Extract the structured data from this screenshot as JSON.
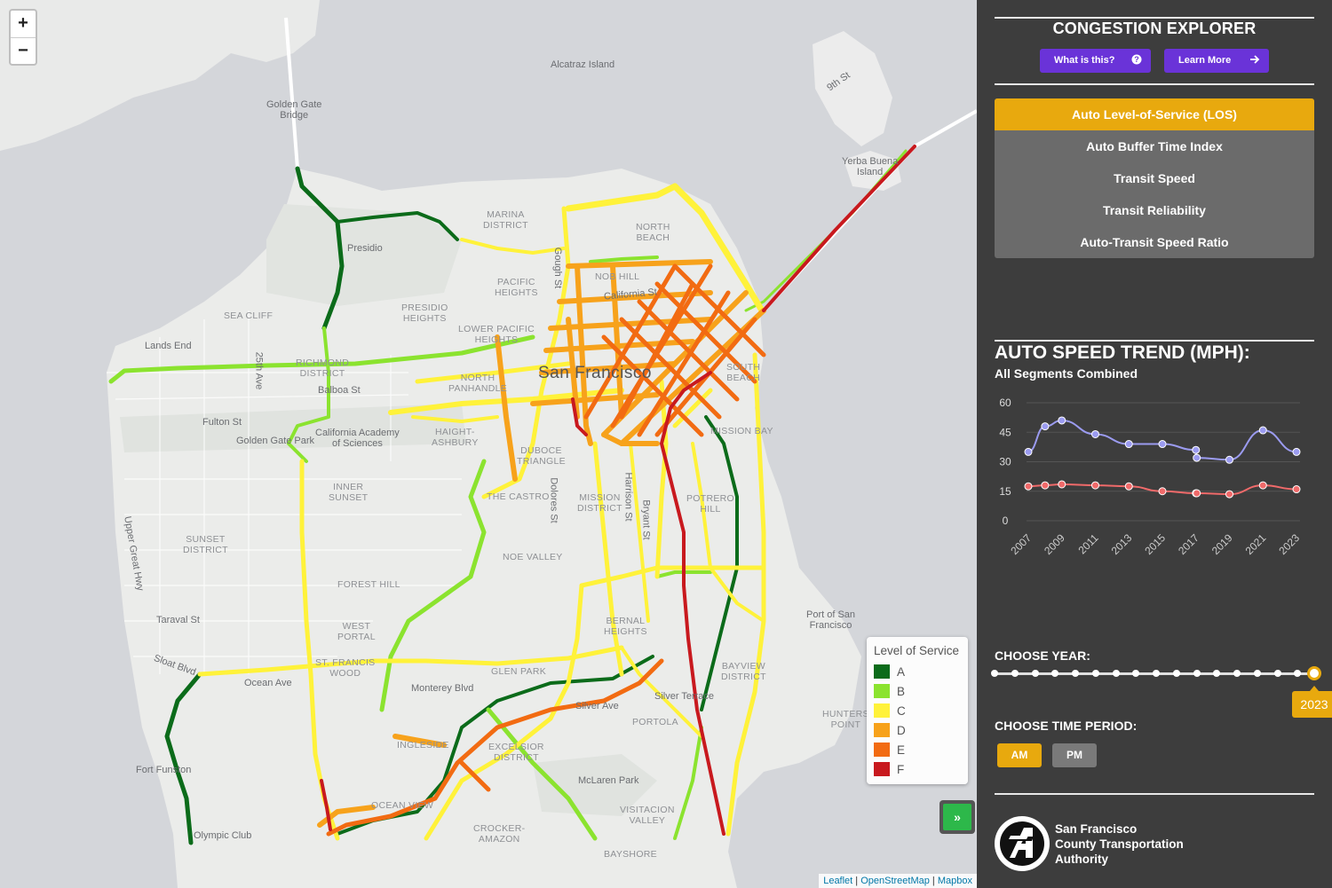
{
  "map": {
    "zoom_in_label": "+",
    "zoom_out_label": "−",
    "labels": {
      "alcatraz": "Alcatraz Island",
      "golden_gate_bridge": "Golden Gate\nBridge",
      "ninth_st": "9th St",
      "yerba_buena": "Yerba Buena\nIsland",
      "marina": "MARINA\nDISTRICT",
      "north_beach": "NORTH\nBEACH",
      "presidio": "Presidio",
      "pacific_heights": "PACIFIC\nHEIGHTS",
      "presidio_heights": "PRESIDIO\nHEIGHTS",
      "nob_hill": "NOB HILL",
      "california_st": "California St",
      "gough_st": "Gough St",
      "sea_cliff": "SEA CLIFF",
      "lands_end": "Lands End",
      "richmond": "RICHMOND\nDISTRICT",
      "ave_25th": "25th Ave",
      "balboa_st": "Balboa St",
      "lower_pacific": "LOWER PACIFIC\nHEIGHTS",
      "north_panhandle": "NORTH\nPANHANDLE",
      "san_francisco": "San Francisco",
      "south_beach": "SOUTH\nBEACH",
      "fulton_st": "Fulton St",
      "golden_gate_park": "Golden Gate Park",
      "cal_academy": "California Academy\nof Sciences",
      "haight": "HAIGHT-\nASHBURY",
      "duboce": "DUBOCE\nTRIANGLE",
      "mission_bay": "MISSION BAY",
      "inner_sunset": "INNER\nSUNSET",
      "the_castro": "THE CASTRO",
      "dolores_st": "Dolores St",
      "mission_district": "MISSION\nDISTRICT",
      "harrison_st": "Harrison St",
      "bryant_st": "Bryant St",
      "potrero_hill": "POTRERO\nHILL",
      "upper_great_hwy": "Upper Great Hwy",
      "sunset_district": "SUNSET\nDISTRICT",
      "noe_valley": "NOE VALLEY",
      "forest_hill": "FOREST HILL",
      "taraval_st": "Taraval St",
      "west_portal": "WEST\nPORTAL",
      "bernal_heights": "BERNAL\nHEIGHTS",
      "port_of_sf": "Port of San\nFrancisco",
      "sloat_blvd": "Sloat Blvd",
      "st_francis_wood": "ST. FRANCIS\nWOOD",
      "glen_park": "GLEN PARK",
      "ocean_ave": "Ocean Ave",
      "monterey_blvd": "Monterey Blvd",
      "bayview": "BAYVIEW\nDISTRICT",
      "silver_terrace": "Silver Terrace",
      "silver_ave": "Silver Ave",
      "hunters_point": "HUNTERS\nPOINT",
      "portola": "PORTOLA",
      "ingleside": "INGLESIDE",
      "excelsior": "EXCELSIOR\nDISTRICT",
      "fort_funston": "Fort Funston",
      "ocean_view": "OCEAN VIEW",
      "mclaren_park": "McLaren Park",
      "visitacion": "VISITACION\nVALLEY",
      "olympic_club": "Olympic Club",
      "crocker": "CROCKER-\nAMAZON",
      "bayshore": "BAYSHORE"
    },
    "legend": {
      "title": "Level of Service",
      "items": [
        {
          "label": "A",
          "color": "#0b6b1a"
        },
        {
          "label": "B",
          "color": "#8be32f"
        },
        {
          "label": "C",
          "color": "#fff23a"
        },
        {
          "label": "D",
          "color": "#f7a21b"
        },
        {
          "label": "E",
          "color": "#f26b12"
        },
        {
          "label": "F",
          "color": "#c8191e"
        }
      ]
    },
    "collapse_icon": "»",
    "attribution": {
      "leaflet": "Leaflet",
      "osm": "OpenStreetMap",
      "mapbox": "Mapbox",
      "sep": " | "
    }
  },
  "panel": {
    "title": "CONGESTION EXPLORER",
    "what_label": "What is this?",
    "what_icon": "question-circle-icon",
    "learn_label": "Learn More",
    "learn_icon": "arrow-right-icon",
    "metrics": [
      "Auto Level-of-Service (LOS)",
      "Auto Buffer Time Index",
      "Transit Speed",
      "Transit Reliability",
      "Auto-Transit Speed Ratio"
    ],
    "active_metric": 0,
    "trend_title": "AUTO SPEED TREND (MPH):",
    "trend_subtitle": "All Segments Combined",
    "choose_year": "CHOOSE YEAR:",
    "selected_year": "2023",
    "choose_period": "CHOOSE TIME PERIOD:",
    "am_label": "AM",
    "pm_label": "PM",
    "accent": "#e8a90e",
    "purple": "#6a33d8",
    "org_name": "San Francisco\nCounty Transportation\nAuthority"
  },
  "chart_data": {
    "type": "line",
    "x": [
      2007,
      2008,
      2009,
      2011,
      2013,
      2015,
      2017,
      2017.05,
      2019,
      2021,
      2023
    ],
    "x_tick_labels": [
      "2007",
      "2009",
      "2011",
      "2013",
      "2015",
      "2017",
      "2019",
      "2021",
      "2023"
    ],
    "series": [
      {
        "values": [
          35,
          48,
          51,
          44,
          39,
          39,
          36,
          32,
          31,
          46,
          35
        ],
        "color": "#9b9bf0"
      },
      {
        "values": [
          17.5,
          18,
          18.5,
          18,
          17.5,
          15,
          14,
          14,
          13.5,
          18,
          16
        ],
        "color": "#f06a6a"
      }
    ],
    "y_ticks": [
      0,
      15,
      30,
      45,
      60
    ],
    "ylim": [
      0,
      60
    ],
    "title": "AUTO SPEED TREND (MPH):",
    "subtitle": "All Segments Combined",
    "grid": true
  },
  "slider_years": [
    "2007",
    "2008",
    "2009",
    "2010",
    "2011",
    "2012",
    "2013",
    "2014",
    "2015",
    "2016",
    "2017",
    "2018",
    "2019",
    "2020",
    "2021",
    "2022",
    "2023"
  ]
}
